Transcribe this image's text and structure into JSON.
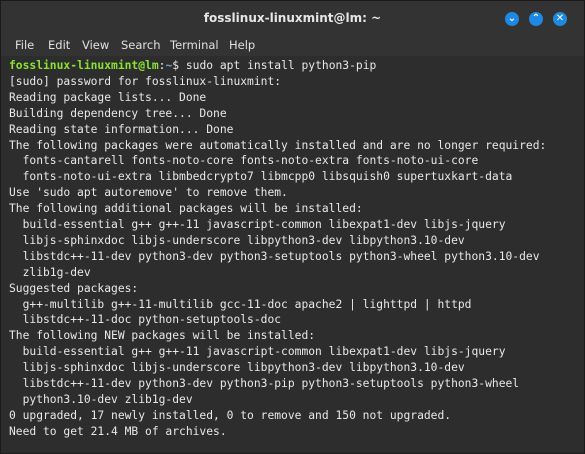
{
  "window": {
    "title": "fosslinux-linuxmint@lm: ~",
    "controls": {
      "minimize": "⌄",
      "maximize": "⌃",
      "close": "✕"
    }
  },
  "menu": {
    "items": [
      "File",
      "Edit",
      "View",
      "Search",
      "Terminal",
      "Help"
    ]
  },
  "terminal": {
    "prompt_user": "fosslinux-linuxmint@lm",
    "prompt_sep": ":",
    "prompt_path": "~",
    "prompt_end": "$ ",
    "command": "sudo apt install python3-pip",
    "lines": [
      "[sudo] password for fosslinux-linuxmint:",
      "Reading package lists... Done",
      "Building dependency tree... Done",
      "Reading state information... Done",
      "The following packages were automatically installed and are no longer required:",
      "  fonts-cantarell fonts-noto-core fonts-noto-extra fonts-noto-ui-core",
      "  fonts-noto-ui-extra libmbedcrypto7 libmcpp0 libsquish0 supertuxkart-data",
      "Use 'sudo apt autoremove' to remove them.",
      "The following additional packages will be installed:",
      "  build-essential g++ g++-11 javascript-common libexpat1-dev libjs-jquery",
      "  libjs-sphinxdoc libjs-underscore libpython3-dev libpython3.10-dev",
      "  libstdc++-11-dev python3-dev python3-setuptools python3-wheel python3.10-dev",
      "  zlib1g-dev",
      "Suggested packages:",
      "  g++-multilib g++-11-multilib gcc-11-doc apache2 | lighttpd | httpd",
      "  libstdc++-11-doc python-setuptools-doc",
      "The following NEW packages will be installed:",
      "  build-essential g++ g++-11 javascript-common libexpat1-dev libjs-jquery",
      "  libjs-sphinxdoc libjs-underscore libpython3-dev libpython3.10-dev",
      "  libstdc++-11-dev python3-dev python3-pip python3-setuptools python3-wheel",
      "  python3.10-dev zlib1g-dev",
      "0 upgraded, 17 newly installed, 0 to remove and 150 not upgraded.",
      "Need to get 21.4 MB of archives."
    ]
  }
}
